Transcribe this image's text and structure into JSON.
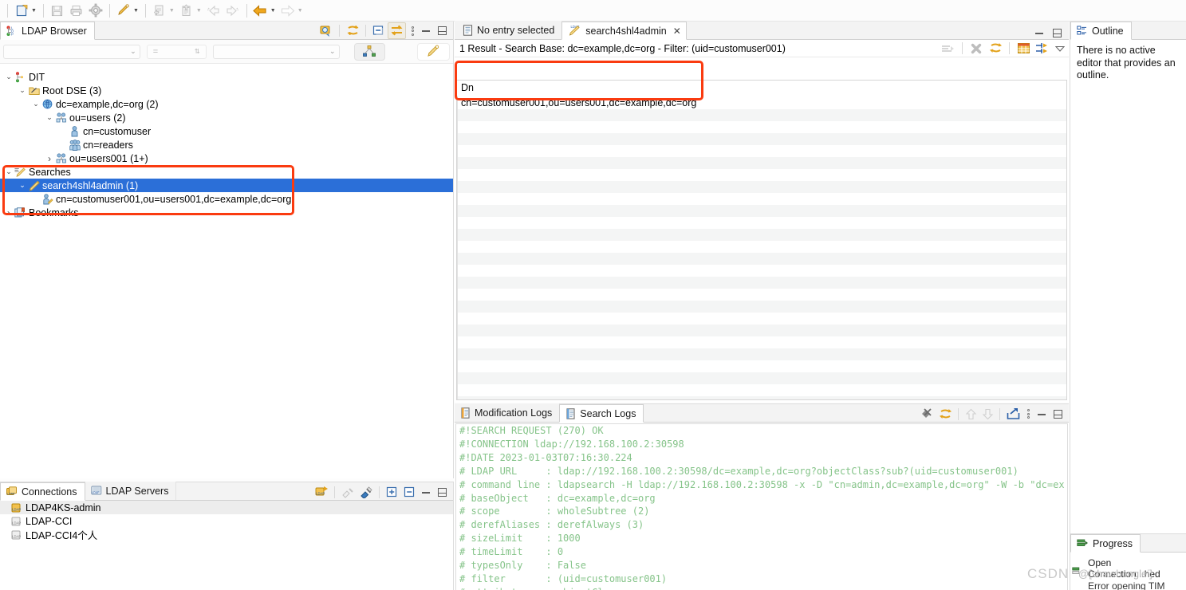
{
  "toolbar": {
    "buttons": [
      {
        "name": "new-icon",
        "label": "New"
      },
      {
        "name": "save-icon",
        "label": "Save"
      },
      {
        "name": "print-icon",
        "label": "Print"
      },
      {
        "name": "preferences-gear-icon",
        "label": "Preferences"
      },
      {
        "name": "new-search-icon",
        "label": "New Search"
      },
      {
        "name": "import-icon",
        "label": "Import"
      },
      {
        "name": "export-icon",
        "label": "Export"
      },
      {
        "name": "back-disabled-icon",
        "label": "Back"
      },
      {
        "name": "forward-disabled-icon",
        "label": "Forward"
      },
      {
        "name": "back-history-icon",
        "label": "Back History"
      },
      {
        "name": "forward-history-icon",
        "label": "Forward History"
      }
    ]
  },
  "ldap_browser": {
    "tab_label": "LDAP Browser",
    "filter": {
      "attribute_value": "",
      "operator": "=",
      "value_value": ""
    },
    "tree": [
      {
        "indent": 0,
        "twisty": "v",
        "icon": "dit-icon",
        "label": "DIT",
        "selected": false
      },
      {
        "indent": 1,
        "twisty": "v",
        "icon": "rootdse-icon",
        "label": "Root DSE (3)",
        "selected": false
      },
      {
        "indent": 2,
        "twisty": "v",
        "icon": "globe-icon",
        "label": "dc=example,dc=org (2)",
        "selected": false
      },
      {
        "indent": 3,
        "twisty": "v",
        "icon": "org-icon",
        "label": "ou=users (2)",
        "selected": false
      },
      {
        "indent": 4,
        "twisty": "",
        "icon": "person-icon",
        "label": "cn=customuser",
        "selected": false
      },
      {
        "indent": 4,
        "twisty": "",
        "icon": "group-icon",
        "label": "cn=readers",
        "selected": false
      },
      {
        "indent": 3,
        "twisty": ">",
        "icon": "org-icon",
        "label": "ou=users001 (1+)",
        "selected": false
      },
      {
        "indent": 0,
        "twisty": "v",
        "icon": "searches-icon",
        "label": "Searches",
        "selected": false
      },
      {
        "indent": 1,
        "twisty": "v",
        "icon": "search-icon",
        "label": "search4shl4admin (1)",
        "selected": true
      },
      {
        "indent": 2,
        "twisty": "",
        "icon": "person-ref-icon",
        "label": "cn=customuser001,ou=users001,dc=example,dc=org",
        "selected": false
      },
      {
        "indent": 0,
        "twisty": ">",
        "icon": "bookmarks-icon",
        "label": "Bookmarks",
        "selected": false
      }
    ]
  },
  "connections": {
    "tabs": [
      {
        "label": "Connections",
        "icon": "connections-icon",
        "active": true
      },
      {
        "label": "LDAP Servers",
        "icon": "ldap-servers-icon",
        "active": false
      }
    ],
    "items": [
      {
        "label": "LDAP4KS-admin",
        "selected": true
      },
      {
        "label": "LDAP-CCI",
        "selected": false
      },
      {
        "label": "LDAP-CCI4个人",
        "selected": false
      }
    ]
  },
  "editor": {
    "tabs": [
      {
        "label": "No entry selected",
        "icon": "entry-editor-icon",
        "active": false,
        "closable": false
      },
      {
        "label": "search4shl4admin",
        "icon": "ldap-search-icon",
        "active": true,
        "closable": true
      }
    ],
    "result_summary": "1 Result  -  Search Base: dc=example,dc=org  -  Filter: (uid=customuser001)",
    "table": {
      "columns": [
        "Dn"
      ],
      "rows": [
        [
          "cn=customuser001,ou=users001,dc=example,dc=org"
        ]
      ]
    }
  },
  "logs": {
    "tabs": [
      {
        "label": "Modification Logs",
        "icon": "log-icon",
        "active": false
      },
      {
        "label": "Search Logs",
        "icon": "log-icon",
        "active": true
      }
    ],
    "content": "#!SEARCH REQUEST (270) OK\n#!CONNECTION ldap://192.168.100.2:30598\n#!DATE 2023-01-03T07:16:30.224\n# LDAP URL     : ldap://192.168.100.2:30598/dc=example,dc=org?objectClass?sub?(uid=customuser001)\n# command line : ldapsearch -H ldap://192.168.100.2:30598 -x -D \"cn=admin,dc=example,dc=org\" -W -b \"dc=ex\n# baseObject   : dc=example,dc=org\n# scope        : wholeSubtree (2)\n# derefAliases : derefAlways (3)\n# sizeLimit    : 1000\n# timeLimit    : 0\n# typesOnly    : False\n# filter       : (uid=customuser001)\n# attributes   : objectClass"
  },
  "outline": {
    "tab_label": "Outline",
    "message": "There is no active editor that provides an outline."
  },
  "progress": {
    "tab_label": "Progress",
    "task": "Open Connection...hed",
    "subtask": "Error opening TIM"
  },
  "watermark": {
    "primary": "CSDN",
    "secondary": "@[shawhonglei]"
  },
  "colors": {
    "selection": "#2b6fd8",
    "annotation": "#fa3b10",
    "log_text": "#86c48a",
    "stripe": "#f4f5f5"
  }
}
